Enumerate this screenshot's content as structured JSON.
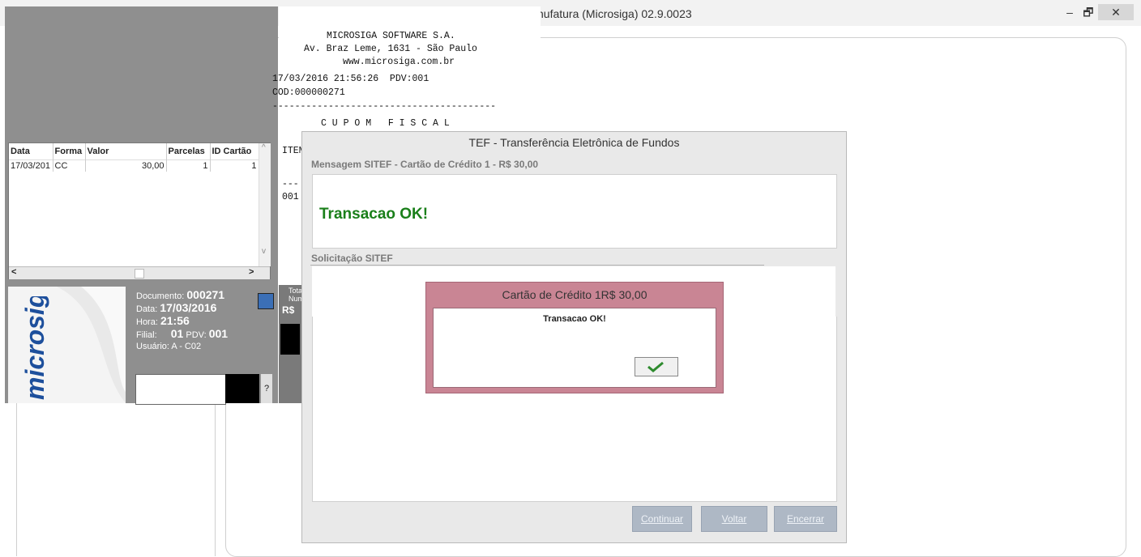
{
  "window": {
    "title": "nufatura (Microsiga) 02.9.0023",
    "minimize": "–",
    "maximize": "🗗",
    "close": "✕"
  },
  "payments": {
    "columns": [
      "Data",
      "Forma",
      "Valor",
      "Parcelas",
      "ID Cartão"
    ],
    "rows": [
      {
        "data": "17/03/201",
        "forma": "CC",
        "valor": "30,00",
        "parcelas": "1",
        "id": "1"
      }
    ],
    "scroll_left": "<",
    "scroll_right": ">",
    "scroll_up": "^",
    "scroll_down": "v"
  },
  "brand": {
    "logo_text": "microsiga"
  },
  "document": {
    "doc_label": "Documento:",
    "doc_value": "000271",
    "date_label": "Data:",
    "date_value": "17/03/2016",
    "time_label": "Hora:",
    "time_value": "21:56",
    "branch_label": "Filial:",
    "branch_value": "01",
    "pdv_label": "PDV:",
    "pdv_value": "001",
    "user_label": "Usuário:",
    "user_value": "A - C02",
    "help": "?"
  },
  "totals": {
    "label1": "Tota",
    "label2": "Num",
    "currency": "R$"
  },
  "receipt": {
    "company": "MICROSIGA SOFTWARE S.A.",
    "address": "Av. Braz Leme, 1631 - São Paulo",
    "site": "www.microsiga.com.br",
    "datetime": "17/03/2016 21:56:26  PDV:001",
    "coo": "COD:000000271",
    "separator": "----------------------------------------",
    "heading": "C U P O M   F I S C A L",
    "item": "ITEM",
    "sep2": "---",
    "item1": "001"
  },
  "tef": {
    "title": "TEF - Transferência Eletrônica de Fundos",
    "message_label": "Mensagem SITEF - Cartão de Crédito 1 - R$ 30,00",
    "message": "Transacao OK!",
    "request_label": "Solicitação SITEF",
    "btn_continue": "Continuar",
    "btn_back": "Voltar",
    "btn_close": "Encerrar"
  },
  "popup": {
    "title": "Cartão de Crédito 1R$ 30,00",
    "message": "Transacao OK!"
  }
}
